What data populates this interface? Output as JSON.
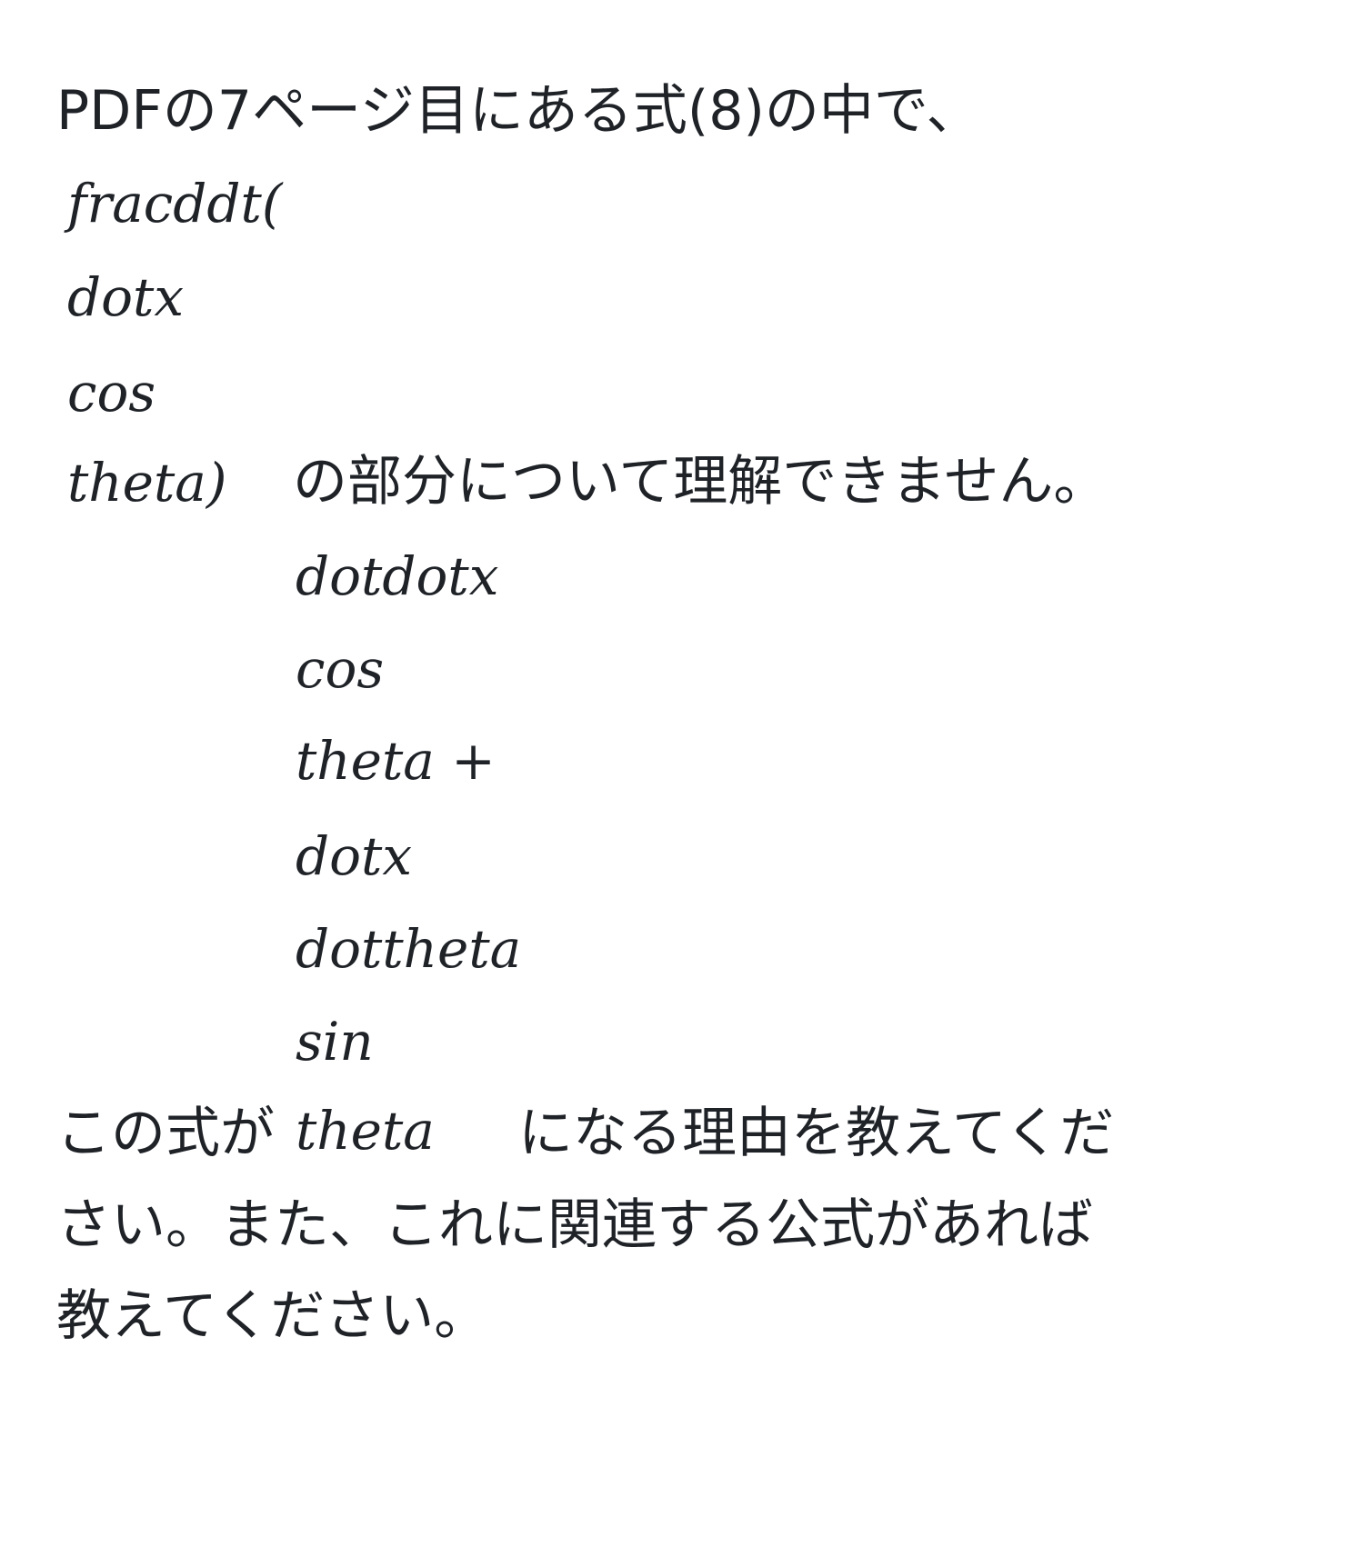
{
  "question": {
    "intro": "PDFの7ページ目にある式(8)の中で、",
    "math_block_1": [
      "fracddt(",
      "dotx",
      "cos",
      "theta)"
    ],
    "after_math_1": "の部分について理解できません。",
    "math_block_2": [
      "dotdotx",
      "cos",
      "theta +",
      "dotx",
      "dottheta",
      "sin"
    ],
    "line_last_prefix": "この式が",
    "inline_math": "theta",
    "line_last_suffix": "になる理由を教えてくだ",
    "line_continuation_1": "さい。また、これに関連する公式があれば",
    "line_continuation_2": "教えてください。"
  },
  "colors": {
    "text": "#1f2328",
    "background": "#ffffff"
  }
}
